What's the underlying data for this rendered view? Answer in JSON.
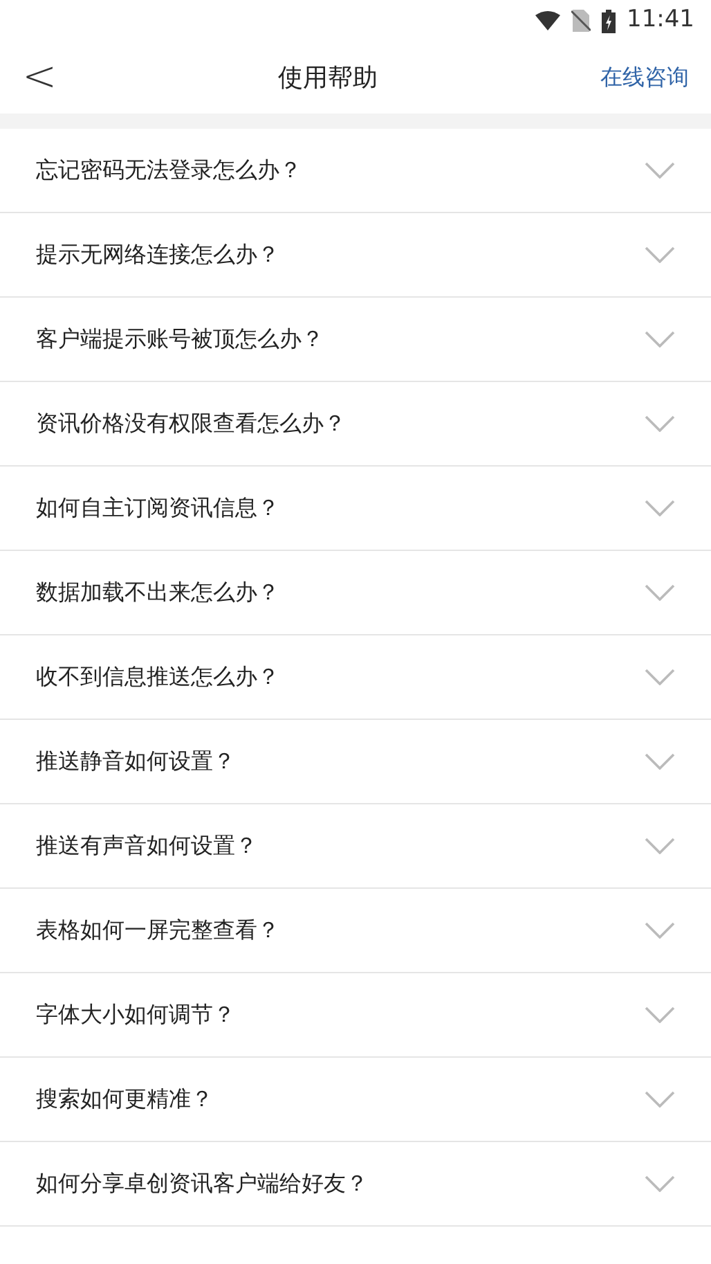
{
  "status_bar": {
    "time": "11:41"
  },
  "header": {
    "back": "<",
    "title": "使用帮助",
    "action": "在线咨询"
  },
  "faq": [
    {
      "question": "忘记密码无法登录怎么办？",
      "expanded": false
    },
    {
      "question": "提示无网络连接怎么办？",
      "expanded": false
    },
    {
      "question": "客户端提示账号被顶怎么办？",
      "expanded": false
    },
    {
      "question": "资讯价格没有权限查看怎么办？",
      "expanded": false
    },
    {
      "question": "如何自主订阅资讯信息？",
      "expanded": false
    },
    {
      "question": "数据加载不出来怎么办？",
      "expanded": false
    },
    {
      "question": "收不到信息推送怎么办？",
      "expanded": false
    },
    {
      "question": "推送静音如何设置？",
      "expanded": false
    },
    {
      "question": "推送有声音如何设置？",
      "expanded": false
    },
    {
      "question": "表格如何一屏完整查看？",
      "expanded": false
    },
    {
      "question": "字体大小如何调节？",
      "expanded": false
    },
    {
      "question": "搜索如何更精准？",
      "expanded": false
    },
    {
      "question": "如何分享卓创资讯客户端给好友？",
      "expanded": false
    }
  ]
}
